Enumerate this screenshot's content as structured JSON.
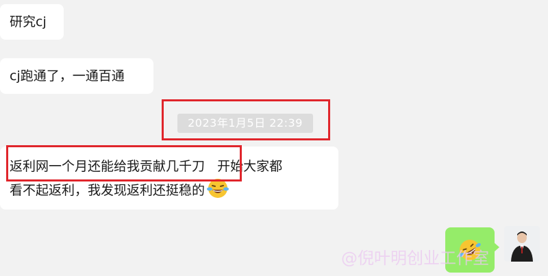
{
  "messages": {
    "m1": "研究cj",
    "m2": "cj跑通了，一通百通",
    "m3_highlight": "返利网一个月还能给我贡献几千刀",
    "m3_rest_line1": "   开始大家都",
    "m3_line2": "看不起返利，我发现返利还挺稳的"
  },
  "timestamp": "2023年1月5日 22:39",
  "icons": {
    "laugh": "laughing-tears-emoji-icon",
    "reply": "rofl-emoji-icon",
    "avatar": "user-avatar"
  },
  "watermark": "@倪叶明创业工作室",
  "colors": {
    "highlight_border": "#e0252b",
    "self_bubble": "#95ec69",
    "background": "#f2f2f2"
  }
}
